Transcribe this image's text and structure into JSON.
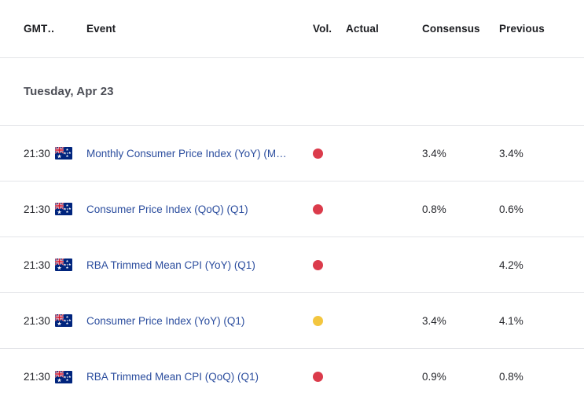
{
  "table": {
    "headers": {
      "time": "GMT…",
      "event": "Event",
      "vol": "Vol.",
      "actual": "Actual",
      "consensus": "Consensus",
      "previous": "Previous"
    },
    "date_group": "Tuesday, Apr 23",
    "rows": [
      {
        "time": "21:30",
        "flag": "australia-flag-icon",
        "country": "Australia",
        "event": "Monthly Consumer Price Index (YoY) (M…",
        "vol": "high",
        "vol_icon": "volatility-dot-high",
        "actual": "",
        "consensus": "3.4%",
        "previous": "3.4%"
      },
      {
        "time": "21:30",
        "flag": "australia-flag-icon",
        "country": "Australia",
        "event": "Consumer Price Index (QoQ) (Q1)",
        "vol": "high",
        "vol_icon": "volatility-dot-high",
        "actual": "",
        "consensus": "0.8%",
        "previous": "0.6%"
      },
      {
        "time": "21:30",
        "flag": "australia-flag-icon",
        "country": "Australia",
        "event": "RBA Trimmed Mean CPI (YoY) (Q1)",
        "vol": "high",
        "vol_icon": "volatility-dot-high",
        "actual": "",
        "consensus": "",
        "previous": "4.2%"
      },
      {
        "time": "21:30",
        "flag": "australia-flag-icon",
        "country": "Australia",
        "event": "Consumer Price Index (YoY) (Q1)",
        "vol": "medium",
        "vol_icon": "volatility-dot-medium",
        "actual": "",
        "consensus": "3.4%",
        "previous": "4.1%"
      },
      {
        "time": "21:30",
        "flag": "australia-flag-icon",
        "country": "Australia",
        "event": "RBA Trimmed Mean CPI (QoQ) (Q1)",
        "vol": "high",
        "vol_icon": "volatility-dot-high",
        "actual": "",
        "consensus": "0.9%",
        "previous": "0.8%"
      }
    ]
  },
  "colors": {
    "volatility_high": "#db3b4b",
    "volatility_medium": "#f3c63f",
    "link": "#2b4d9e",
    "divider": "#e3e4e8",
    "text": "#26272c",
    "date_text": "#4b4d55"
  }
}
